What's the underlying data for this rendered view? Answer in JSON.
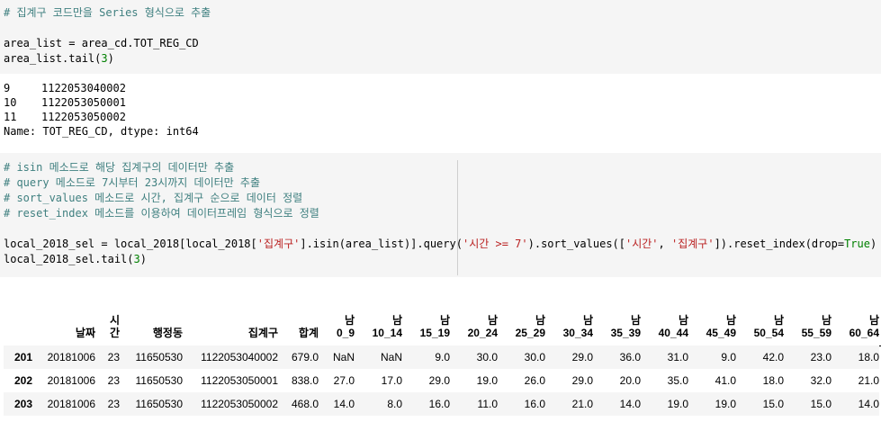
{
  "cell1": {
    "comment": "# 집계구 코드만을 Series 형식으로 추출",
    "line2": "area_list = area_cd.TOT_REG_CD",
    "line3_a": "area_list.tail(",
    "line3_num": "3",
    "line3_b": ")"
  },
  "output1": {
    "rows": [
      {
        "idx": "9",
        "val": "1122053040002"
      },
      {
        "idx": "10",
        "val": "1122053050001"
      },
      {
        "idx": "11",
        "val": "1122053050002"
      }
    ],
    "footer": "Name: TOT_REG_CD, dtype: int64"
  },
  "cell2": {
    "comments": [
      "# isin 메소드로 해당 집계구의 데이터만 추출",
      "# query 메소드로 7시부터 23시까지 데이터만 추출",
      "# sort_values 메소드로 시간, 집계구 순으로 데이터 정렬",
      "# reset_index 메소드를 이용하여 데이터프레임 형식으로 정렬"
    ],
    "code_a": "local_2018_sel = local_2018[local_2018[",
    "str1": "'집계구'",
    "code_b": "].isin(area_list)].query(",
    "str2": "'시간 >= 7'",
    "code_c": ").sort_values([",
    "str3": "'시간'",
    "code_d": ", ",
    "str4": "'집계구'",
    "code_e": "]).reset_index(drop=",
    "true_kw": "True",
    "code_f": ")",
    "tail_a": "local_2018_sel.tail(",
    "tail_num": "3",
    "tail_b": ")"
  },
  "table": {
    "headers": [
      {
        "l1": "",
        "l2": ""
      },
      {
        "l1": "",
        "l2": "날짜"
      },
      {
        "l1": "시",
        "l2": "간"
      },
      {
        "l1": "",
        "l2": "행정동"
      },
      {
        "l1": "",
        "l2": "집계구"
      },
      {
        "l1": "",
        "l2": "합계"
      },
      {
        "l1": "남",
        "l2": "0_9"
      },
      {
        "l1": "남",
        "l2": "10_14"
      },
      {
        "l1": "남",
        "l2": "15_19"
      },
      {
        "l1": "남",
        "l2": "20_24"
      },
      {
        "l1": "남",
        "l2": "25_29"
      },
      {
        "l1": "남",
        "l2": "30_34"
      },
      {
        "l1": "남",
        "l2": "35_39"
      },
      {
        "l1": "남",
        "l2": "40_44"
      },
      {
        "l1": "남",
        "l2": "45_49"
      },
      {
        "l1": "남",
        "l2": "50_54"
      },
      {
        "l1": "남",
        "l2": "55_59"
      },
      {
        "l1": "남",
        "l2": "60_64"
      }
    ],
    "rows": [
      [
        "201",
        "20181006",
        "23",
        "11650530",
        "1122053040002",
        "679.0",
        "NaN",
        "NaN",
        "9.0",
        "30.0",
        "30.0",
        "29.0",
        "36.0",
        "31.0",
        "9.0",
        "42.0",
        "23.0",
        "18.0"
      ],
      [
        "202",
        "20181006",
        "23",
        "11650530",
        "1122053050001",
        "838.0",
        "27.0",
        "17.0",
        "29.0",
        "19.0",
        "26.0",
        "29.0",
        "20.0",
        "35.0",
        "41.0",
        "18.0",
        "32.0",
        "21.0"
      ],
      [
        "203",
        "20181006",
        "23",
        "11650530",
        "1122053050002",
        "468.0",
        "14.0",
        "8.0",
        "16.0",
        "11.0",
        "16.0",
        "21.0",
        "14.0",
        "19.0",
        "19.0",
        "15.0",
        "15.0",
        "14.0"
      ]
    ]
  }
}
